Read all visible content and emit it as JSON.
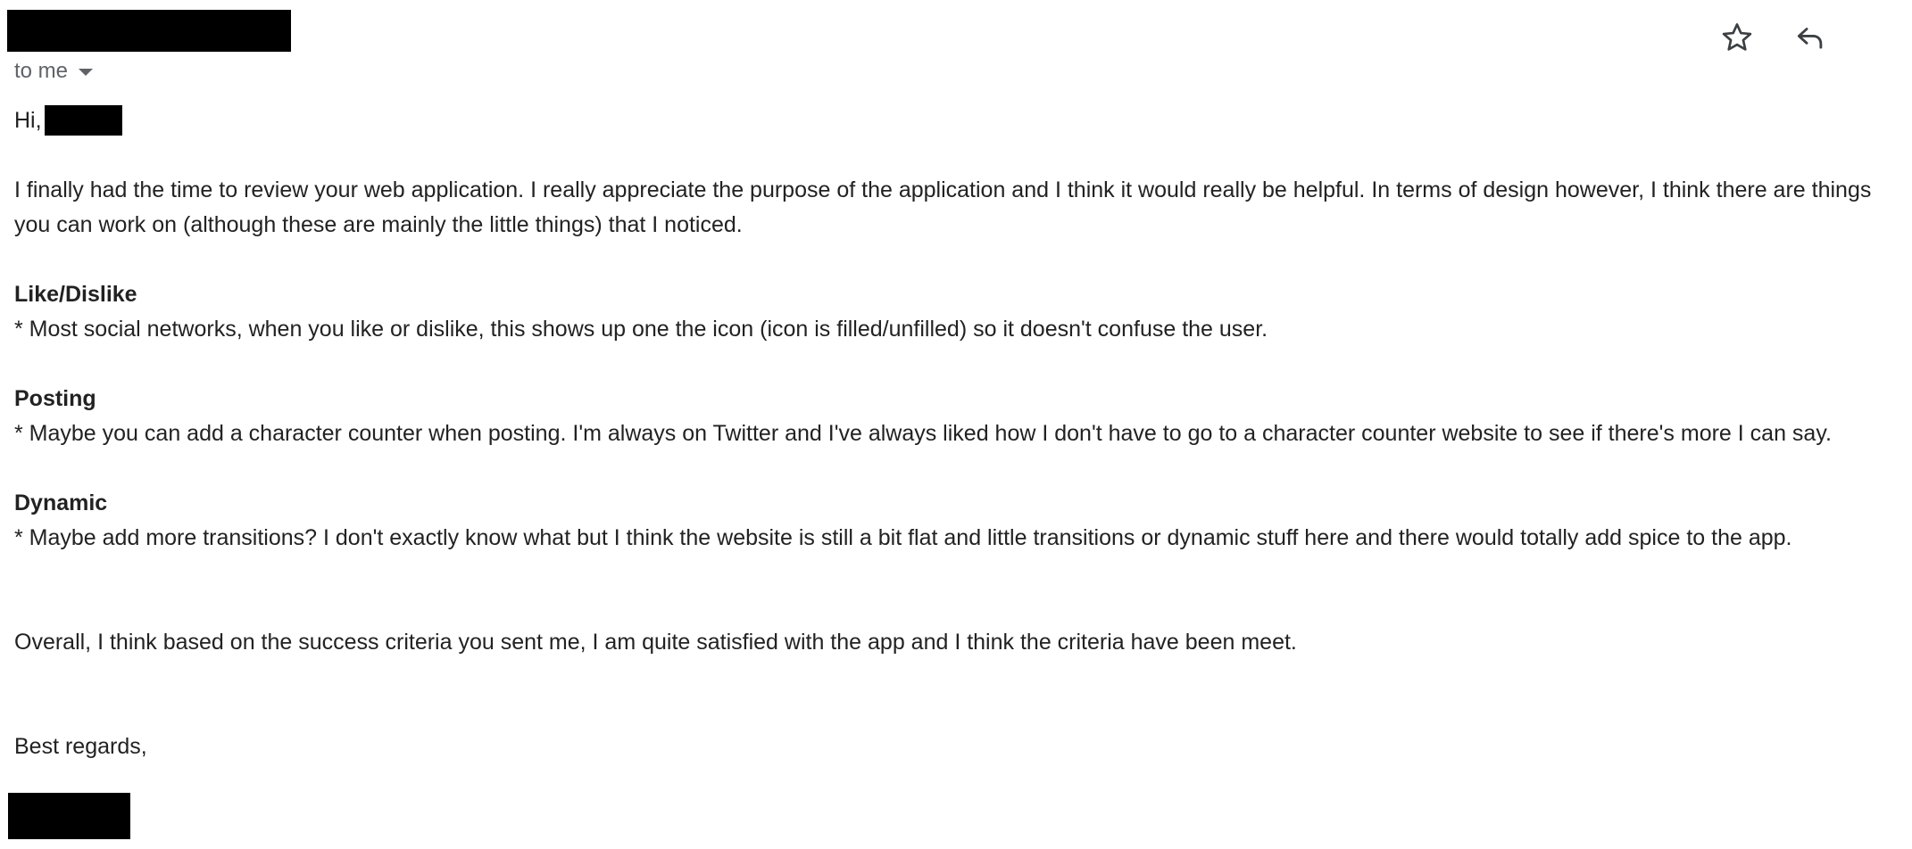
{
  "header": {
    "recipient_label": "to me"
  },
  "actions": {
    "star_icon": "star-icon",
    "reply_icon": "reply-icon"
  },
  "message": {
    "greeting": "Hi,",
    "intro": "I finally had the time to review your web application. I really appreciate the purpose of the application and I think it would really be helpful. In terms of design however, I think there are things you can work on (although these are mainly the little things) that I noticed.",
    "sections": [
      {
        "title": "Like/Dislike",
        "text": "* Most social networks, when you like or dislike, this shows up one the icon (icon is filled/unfilled) so it doesn't confuse the user."
      },
      {
        "title": "Posting",
        "text": "* Maybe you can add a character counter when posting. I'm always on Twitter and I've always liked how I don't have to go to a character counter website to see if there's more I can say."
      },
      {
        "title": "Dynamic",
        "text": "* Maybe add more transitions? I don't exactly know what but I think the website is still a bit flat and little transitions or dynamic stuff here and there would totally add spice to the app."
      }
    ],
    "overall": "Overall, I think based on the success criteria you sent me, I am quite satisfied with the app and I think the criteria have been meet.",
    "closing": "Best regards,"
  }
}
